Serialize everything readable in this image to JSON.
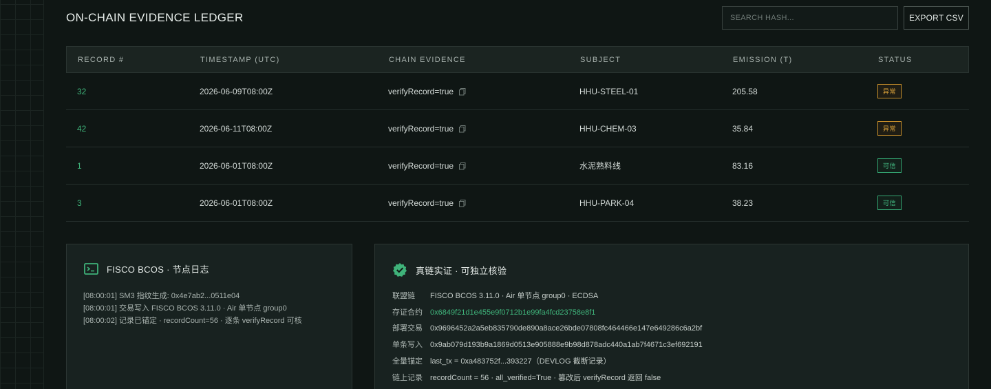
{
  "header": {
    "title": "ON-CHAIN EVIDENCE LEDGER",
    "search_placeholder": "SEARCH HASH...",
    "export_label": "EXPORT CSV"
  },
  "table": {
    "columns": [
      "RECORD #",
      "TIMESTAMP (UTC)",
      "CHAIN EVIDENCE",
      "SUBJECT",
      "EMISSION (T)",
      "STATUS"
    ],
    "rows": [
      {
        "record": "32",
        "timestamp": "2026-06-09T08:00Z",
        "evidence": "verifyRecord=true",
        "subject": "HHU-STEEL-01",
        "emission": "205.58",
        "status": "异常",
        "status_type": "warn"
      },
      {
        "record": "42",
        "timestamp": "2026-06-11T08:00Z",
        "evidence": "verifyRecord=true",
        "subject": "HHU-CHEM-03",
        "emission": "35.84",
        "status": "异常",
        "status_type": "warn"
      },
      {
        "record": "1",
        "timestamp": "2026-06-01T08:00Z",
        "evidence": "verifyRecord=true",
        "subject": "水泥熟料线",
        "emission": "83.16",
        "status": "可信",
        "status_type": "ok"
      },
      {
        "record": "3",
        "timestamp": "2026-06-01T08:00Z",
        "evidence": "verifyRecord=true",
        "subject": "HHU-PARK-04",
        "emission": "38.23",
        "status": "可信",
        "status_type": "ok"
      }
    ]
  },
  "node_log": {
    "title": "FISCO BCOS · 节点日志",
    "icon": "terminal-icon",
    "lines": [
      "[08:00:01] SM3 指纹生成: 0x4e7ab2...0511e04",
      "[08:00:01] 交易写入 FISCO BCOS 3.11.0 · Air 单节点 group0",
      "[08:00:02] 记录已锚定 · recordCount=56 · 逐条 verifyRecord 可核"
    ]
  },
  "verify": {
    "title": "真链实证 · 可独立核验",
    "icon": "verified-badge-icon",
    "items": [
      {
        "key": "联盟链",
        "value": "FISCO BCOS 3.11.0 · Air 单节点 group0 · ECDSA"
      },
      {
        "key": "存证合约",
        "value": "0x6849f21d1e455e9f0712b1e99fa4fcd23758e8f1"
      },
      {
        "key": "部署交易",
        "value": "0x9696452a2a5eb835790de890a8ace26bde07808fc464466e147e649286c6a2bf"
      },
      {
        "key": "单条写入",
        "value": "0x9ab079d193b9a1869d0513e905888e9b98d878adc440a1ab7f4671c3ef692191"
      },
      {
        "key": "全量锚定",
        "value": "last_tx = 0xa483752f...393227（DEVLOG 截断记录）"
      },
      {
        "key": "链上记录",
        "value": "recordCount = 56 · all_verified=True · 篡改后 verifyRecord 返回 false"
      }
    ]
  },
  "colors": {
    "accent_green": "#3fb37a",
    "warn_amber": "#e0a63b",
    "background": "#0f1614"
  }
}
